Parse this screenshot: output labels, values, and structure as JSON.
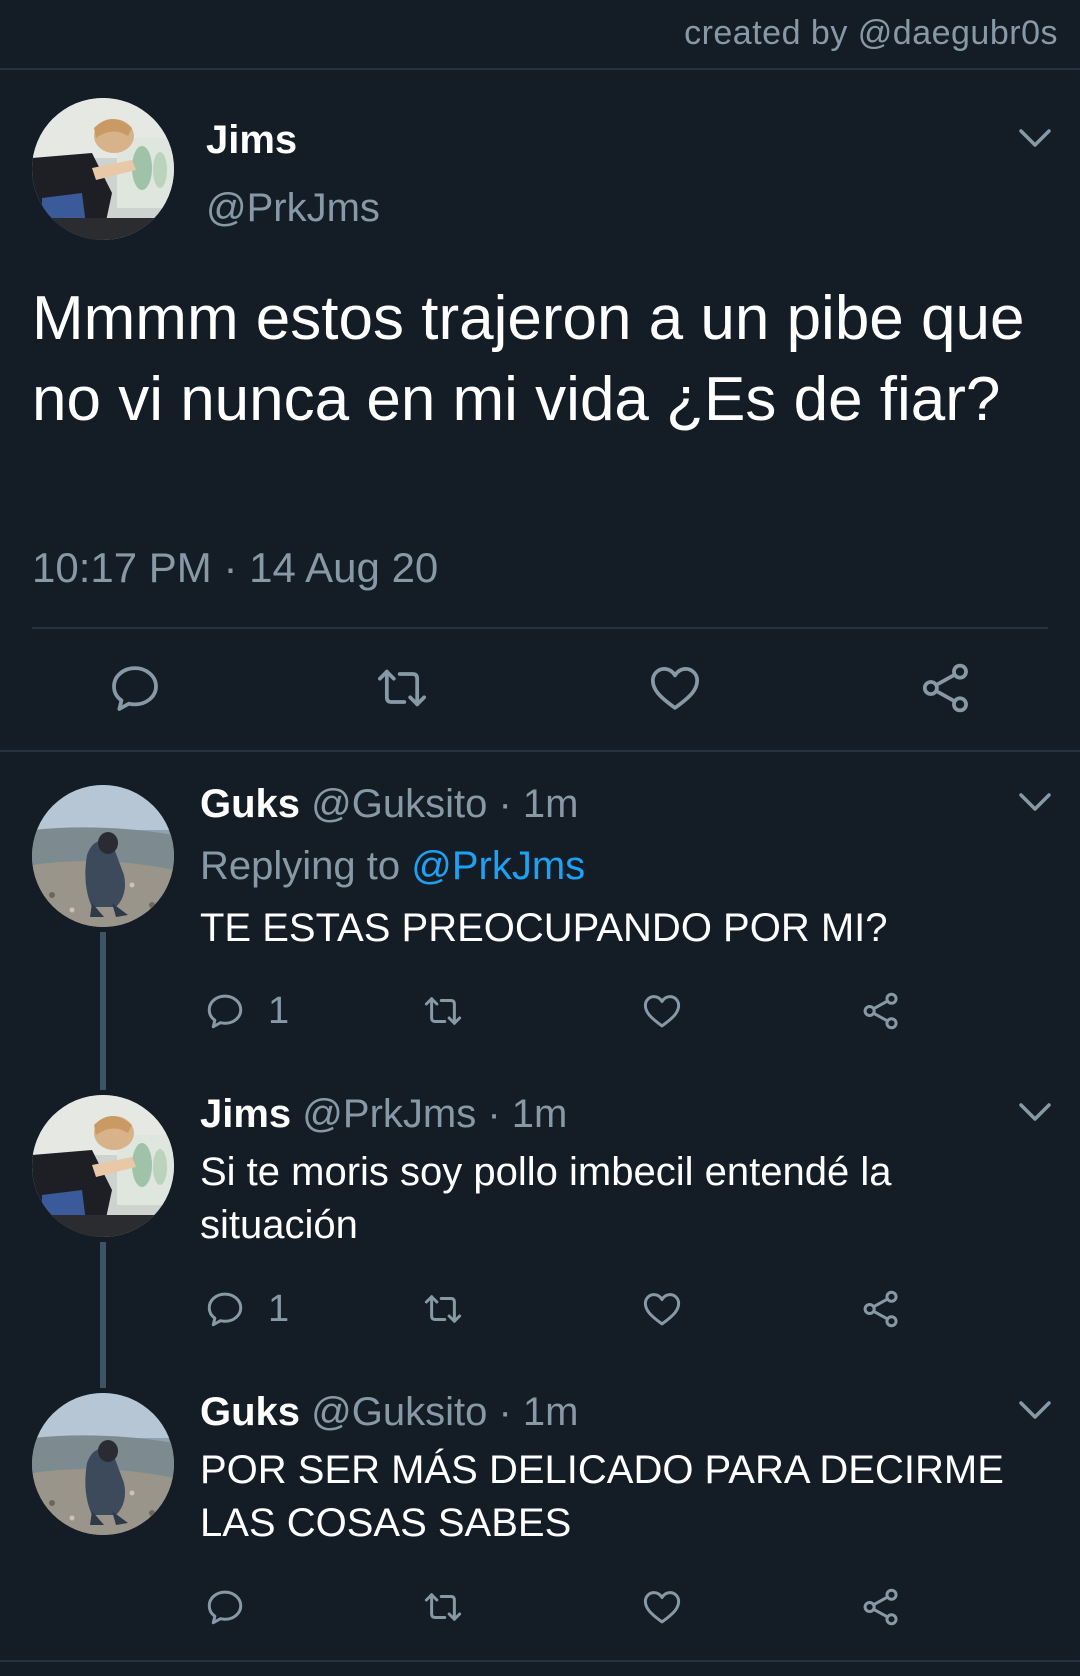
{
  "header": {
    "credit": "created by @daegubr0s"
  },
  "main_tweet": {
    "name": "Jims",
    "handle": "@PrkJms",
    "text": "Mmmm estos trajeron a un pibe que no vi nunca en mi vida ¿Es de fiar?",
    "timestamp": "10:17 PM · 14 Aug 20",
    "actions": [
      "reply-icon",
      "retweet-icon",
      "like-icon",
      "share-icon"
    ]
  },
  "replies": [
    {
      "name": "Guks",
      "meta": "@Guksito · 1m",
      "replying_label": "Replying to",
      "replying_mention": "@PrkJms",
      "text": "TE ESTAS PREOCUPANDO POR MI?",
      "reply_count": "1"
    },
    {
      "name": "Jims",
      "meta": "@PrkJms · 1m",
      "text": "Si te moris soy pollo imbecil entendé la situación",
      "reply_count": "1"
    },
    {
      "name": "Guks",
      "meta": "@Guksito · 1m",
      "text": "POR SER MÁS DELICADO PARA DECIRME LAS  COSAS SABES",
      "reply_count": ""
    }
  ],
  "colors": {
    "background": "#141d26",
    "divider": "#253341",
    "secondary_text": "#8899a6",
    "link": "#1da1f2"
  }
}
